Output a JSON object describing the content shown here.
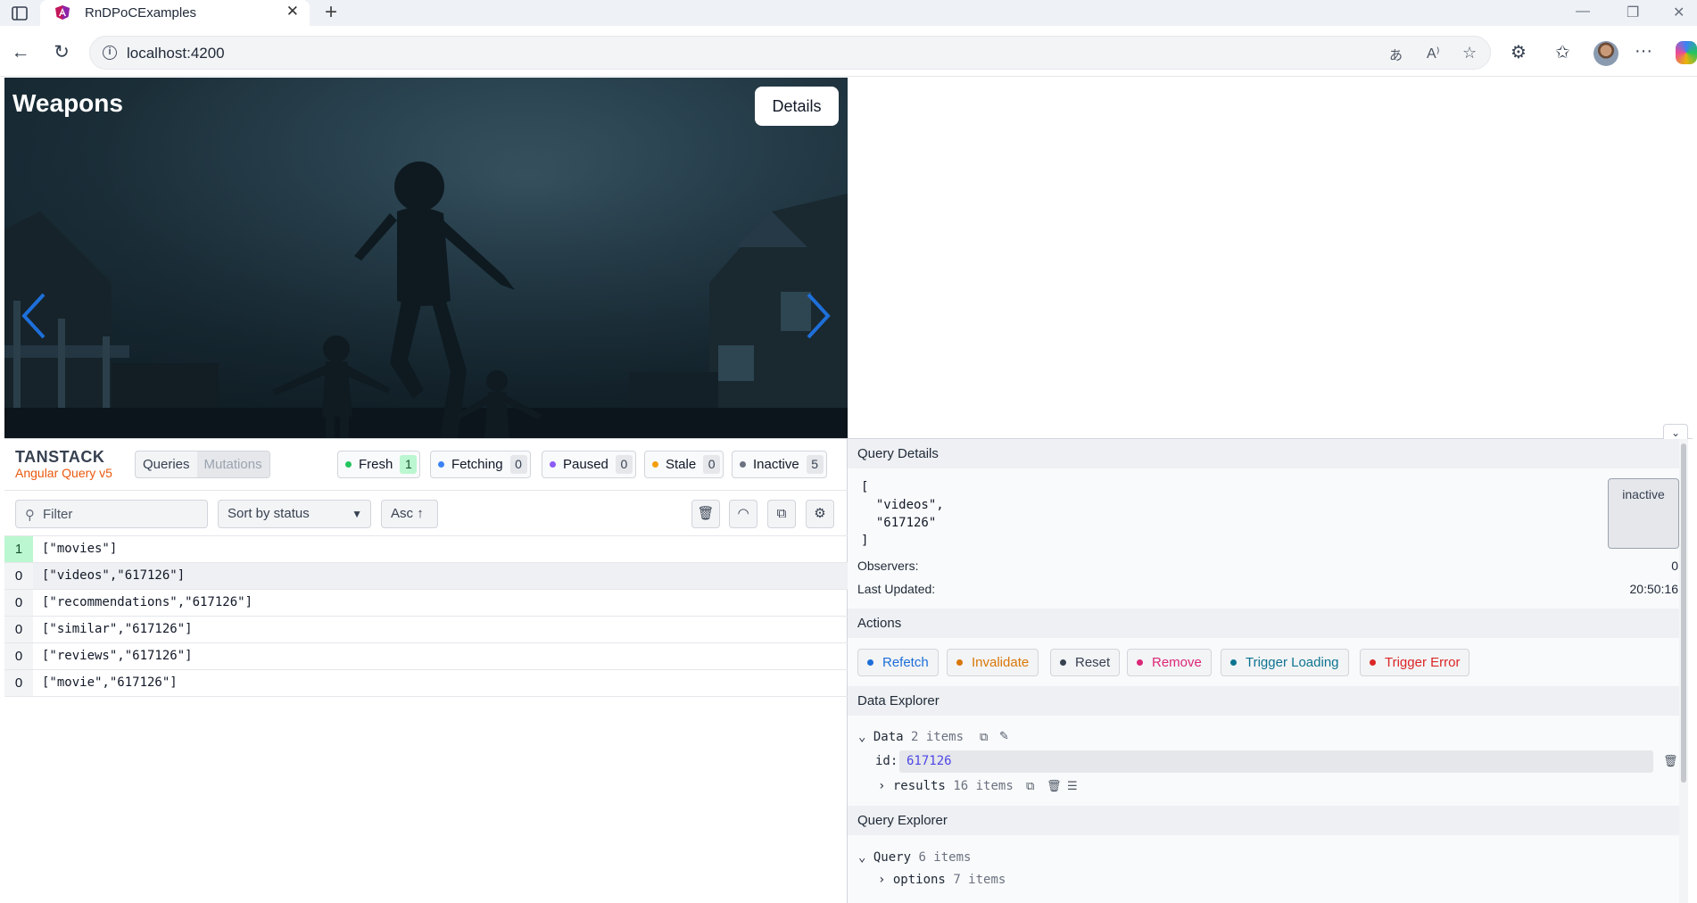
{
  "browser": {
    "tab_title": "RnDPoCExamples",
    "url": "localhost:4200",
    "tab_close": "✕",
    "new_tab": "+"
  },
  "hero": {
    "title": "Weapons",
    "details_label": "Details"
  },
  "devtools": {
    "logo_top": "TANSTACK",
    "logo_sub": "Angular Query v5",
    "tabs": [
      "Queries",
      "Mutations"
    ],
    "status_chips": [
      {
        "label": "Fresh",
        "count": "1",
        "color": "#22c55e"
      },
      {
        "label": "Fetching",
        "count": "0",
        "color": "#3b82f6"
      },
      {
        "label": "Paused",
        "count": "0",
        "color": "#8b5cf6"
      },
      {
        "label": "Stale",
        "count": "0",
        "color": "#f59e0b"
      },
      {
        "label": "Inactive",
        "count": "5",
        "color": "#6b7280"
      }
    ],
    "filter_placeholder": "Filter",
    "sort_label": "Sort by status",
    "order_label": "Asc",
    "queries": [
      {
        "count": "1",
        "key": "[\"movies\"]",
        "fresh": true
      },
      {
        "count": "0",
        "key": "[\"videos\",\"617126\"]",
        "fresh": false,
        "selected": true
      },
      {
        "count": "0",
        "key": "[\"recommendations\",\"617126\"]",
        "fresh": false
      },
      {
        "count": "0",
        "key": "[\"similar\",\"617126\"]",
        "fresh": false
      },
      {
        "count": "0",
        "key": "[\"reviews\",\"617126\"]",
        "fresh": false
      },
      {
        "count": "0",
        "key": "[\"movie\",\"617126\"]",
        "fresh": false
      }
    ],
    "details": {
      "header": "Query Details",
      "query_key": "[\n  \"videos\",\n  \"617126\"\n]",
      "state": "inactive",
      "observers_label": "Observers:",
      "observers_value": "0",
      "updated_label": "Last Updated:",
      "updated_value": "20:50:16"
    },
    "actions": {
      "header": "Actions",
      "buttons": [
        {
          "label": "Refetch",
          "color": "#1d6fd8"
        },
        {
          "label": "Invalidate",
          "color": "#d97706"
        },
        {
          "label": "Reset",
          "color": "#374151"
        },
        {
          "label": "Remove",
          "color": "#db2777"
        },
        {
          "label": "Trigger Loading",
          "color": "#0e7490"
        },
        {
          "label": "Trigger Error",
          "color": "#dc2626"
        }
      ]
    },
    "data_explorer": {
      "header": "Data Explorer",
      "root_label": "Data",
      "root_count": "2 items",
      "id_label": "id:",
      "id_value": "617126",
      "results_label": "results",
      "results_count": "16 items"
    },
    "query_explorer": {
      "header": "Query Explorer",
      "root_label": "Query",
      "root_count": "6 items",
      "options_label": "options",
      "options_count": "7 items"
    }
  }
}
